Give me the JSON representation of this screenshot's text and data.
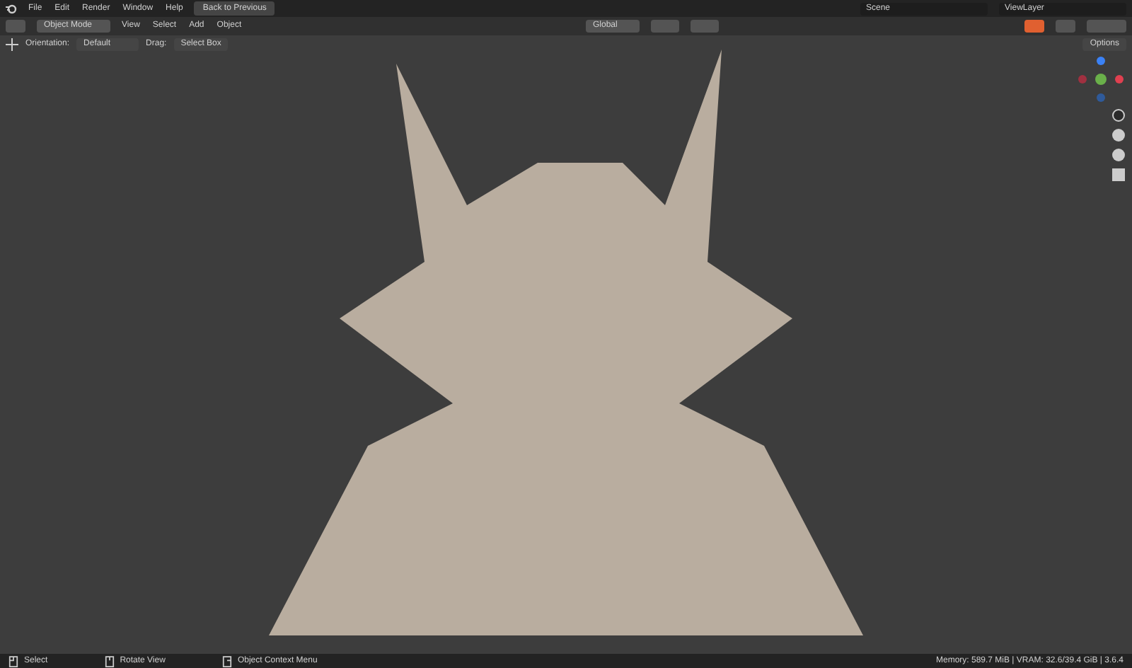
{
  "top_bar": {
    "menus": [
      "File",
      "Edit",
      "Render",
      "Window",
      "Help"
    ],
    "back_button": "Back to Previous",
    "scene": "Scene",
    "view_layer": "ViewLayer"
  },
  "header": {
    "mode": "Object Mode",
    "menus": [
      "View",
      "Select",
      "Add",
      "Object"
    ],
    "orientation_global": "Global"
  },
  "tool_settings": {
    "orientation_label": "Orientation:",
    "orientation": "Default",
    "drag_label": "Drag:",
    "drag": "Select Box",
    "options": "Options"
  },
  "status_bar": {
    "hints": [
      {
        "kind": "left-click",
        "label": "Select"
      },
      {
        "kind": "middle-click",
        "label": "Rotate View"
      },
      {
        "kind": "right-click",
        "label": "Object Context Menu"
      }
    ],
    "info": "Memory: 589.7 MiB | VRAM: 32.6/39.4 GiB | 3.6.4"
  }
}
